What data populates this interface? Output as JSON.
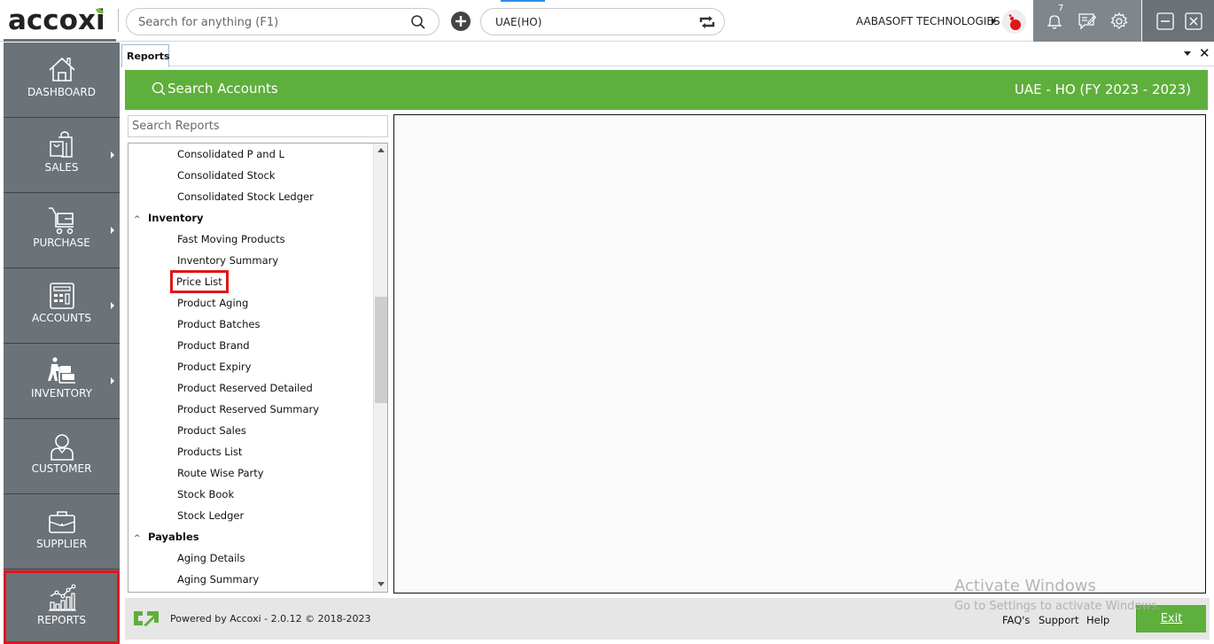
{
  "app": {
    "logo_text": "accoxi",
    "search_placeholder": "Search for anything (F1)",
    "branch": "UAE(HO)",
    "company": "AABASOFT TECHNOLOGIES",
    "notification_count": "7"
  },
  "sidebar": {
    "items": [
      {
        "label": "DASHBOARD",
        "icon": "home-icon",
        "has_submenu": false
      },
      {
        "label": "SALES",
        "icon": "shopping-bag-icon",
        "has_submenu": true
      },
      {
        "label": "PURCHASE",
        "icon": "cart-icon",
        "has_submenu": true
      },
      {
        "label": "ACCOUNTS",
        "icon": "calculator-icon",
        "has_submenu": true
      },
      {
        "label": "INVENTORY",
        "icon": "warehouse-worker-icon",
        "has_submenu": true
      },
      {
        "label": "CUSTOMER",
        "icon": "person-icon",
        "has_submenu": false
      },
      {
        "label": "SUPPLIER",
        "icon": "briefcase-icon",
        "has_submenu": false
      },
      {
        "label": "REPORTS",
        "icon": "chart-icon",
        "has_submenu": false,
        "active": true
      }
    ]
  },
  "tabs": [
    {
      "label": "Reports",
      "active": true
    }
  ],
  "header": {
    "search_accounts": "Search Accounts",
    "fiscal_year": "UAE - HO (FY 2023 - 2023)"
  },
  "reports": {
    "search_placeholder": "Search Reports",
    "tree": [
      {
        "type": "child",
        "label": "Consolidated P and L"
      },
      {
        "type": "child",
        "label": "Consolidated Stock"
      },
      {
        "type": "child",
        "label": "Consolidated Stock Ledger"
      },
      {
        "type": "group",
        "label": "Inventory",
        "expanded": true
      },
      {
        "type": "child",
        "label": "Fast Moving Products"
      },
      {
        "type": "child",
        "label": "Inventory Summary"
      },
      {
        "type": "child",
        "label": "Price List",
        "highlighted": true
      },
      {
        "type": "child",
        "label": "Product Aging"
      },
      {
        "type": "child",
        "label": "Product Batches"
      },
      {
        "type": "child",
        "label": "Product Brand"
      },
      {
        "type": "child",
        "label": "Product Expiry"
      },
      {
        "type": "child",
        "label": "Product Reserved Detailed"
      },
      {
        "type": "child",
        "label": "Product Reserved Summary"
      },
      {
        "type": "child",
        "label": "Product Sales"
      },
      {
        "type": "child",
        "label": "Products List"
      },
      {
        "type": "child",
        "label": "Route Wise Party"
      },
      {
        "type": "child",
        "label": "Stock Book"
      },
      {
        "type": "child",
        "label": "Stock Ledger"
      },
      {
        "type": "group",
        "label": "Payables",
        "expanded": true
      },
      {
        "type": "child",
        "label": "Aging Details"
      },
      {
        "type": "child",
        "label": "Aging Summary"
      }
    ]
  },
  "footer": {
    "powered_by": "Powered by Accoxi - 2.0.12 © 2018-2023",
    "faqs": "FAQ's",
    "support": "Support",
    "help": "Help",
    "exit_label": "Exit"
  },
  "watermark": {
    "line1": "Activate Windows",
    "line2": "Go to Settings to activate Windows."
  },
  "colors": {
    "brand_green": "#5faf3c",
    "sidebar_bg": "#6b7278",
    "highlight_red": "#e0161c"
  }
}
